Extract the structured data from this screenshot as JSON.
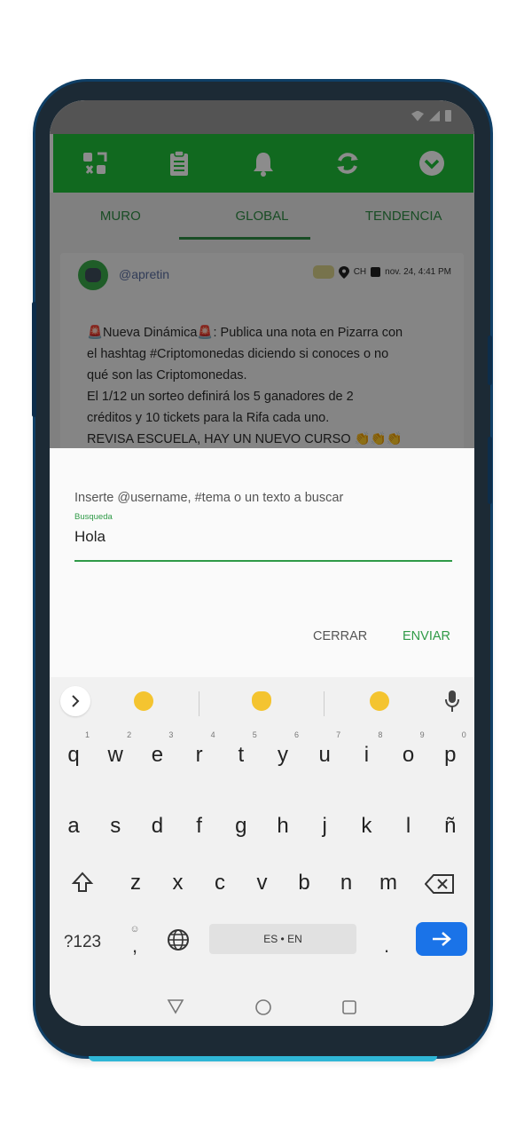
{
  "appbar": {
    "icons": [
      "tools-icon",
      "clipboard-icon",
      "bell-icon",
      "refresh-icon",
      "chevron-circle-icon"
    ],
    "color": "#1fbf3a"
  },
  "tabs": [
    "MURO",
    "GLOBAL",
    "TENDENCIA"
  ],
  "active_tab": "GLOBAL",
  "post": {
    "username": "@apretin",
    "location": "CH",
    "date": "nov. 24, 4:41 PM",
    "lines": [
      "🚨Nueva Dinámica🚨: Publica una nota en Pizarra con",
      "el hashtag #Criptomonedas diciendo si conoces o no",
      "qué son las Criptomonedas.",
      "El 1/12 un sorteo definirá los 5 ganadores de 2",
      "créditos y 10 tickets para la Rifa cada uno.",
      "REVISA ESCUELA, HAY UN NUEVO CURSO 👏👏👏"
    ]
  },
  "search_dialog": {
    "label": "Inserte @username, #tema o un texto a buscar",
    "floating_label": "Busqueda",
    "value": "Hola",
    "cancel": "CERRAR",
    "submit": "ENVIAR",
    "accent": "#2f9a47"
  },
  "keyboard": {
    "row1": [
      {
        "k": "q",
        "h": "1"
      },
      {
        "k": "w",
        "h": "2"
      },
      {
        "k": "e",
        "h": "3"
      },
      {
        "k": "r",
        "h": "4"
      },
      {
        "k": "t",
        "h": "5"
      },
      {
        "k": "y",
        "h": "6"
      },
      {
        "k": "u",
        "h": "7"
      },
      {
        "k": "i",
        "h": "8"
      },
      {
        "k": "o",
        "h": "9"
      },
      {
        "k": "p",
        "h": "0"
      }
    ],
    "row2": [
      "a",
      "s",
      "d",
      "f",
      "g",
      "h",
      "j",
      "k",
      "l",
      "ñ"
    ],
    "row3": [
      "z",
      "x",
      "c",
      "v",
      "b",
      "n",
      "m"
    ],
    "symbols": "?123",
    "comma_hint": "☺",
    "comma": ",",
    "space": "ES • EN",
    "period": ".",
    "enter_color": "#1a73e8"
  }
}
